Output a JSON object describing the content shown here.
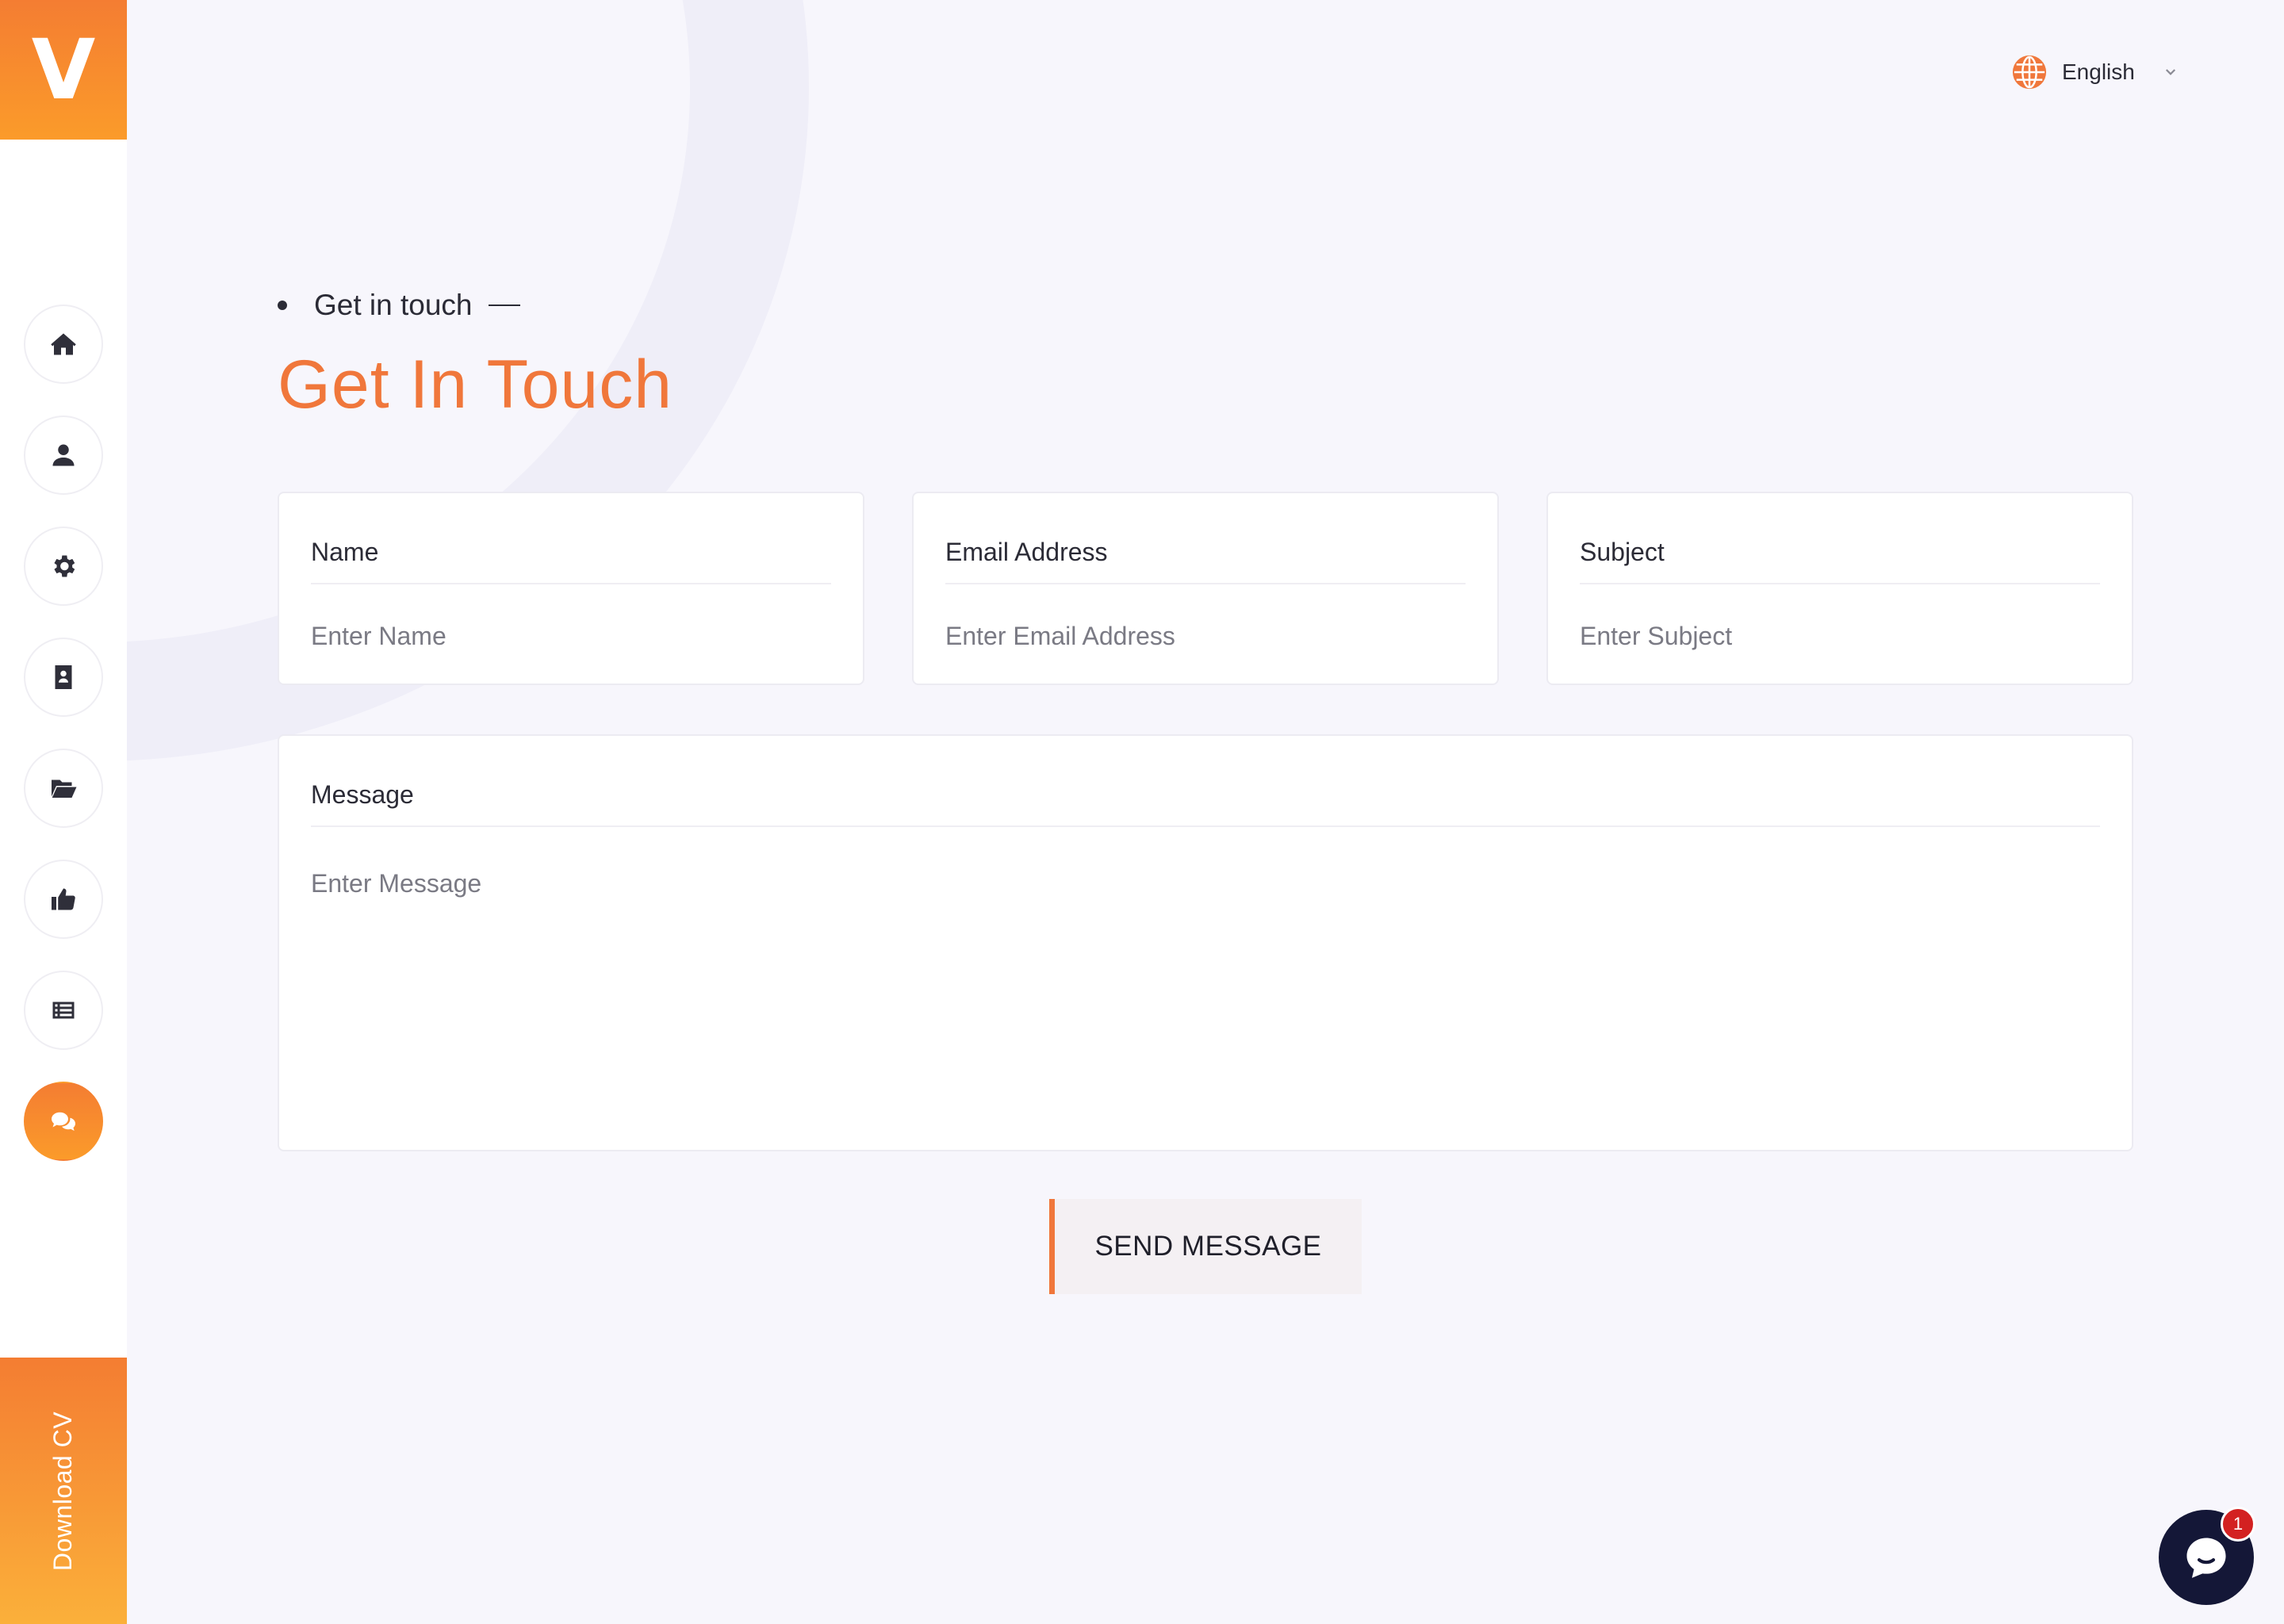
{
  "brand": {
    "logo_letter": "V",
    "accent": "#f0773b"
  },
  "sidebar": {
    "items": [
      {
        "icon": "home-icon",
        "active": false
      },
      {
        "icon": "user-icon",
        "active": false
      },
      {
        "icon": "gear-icon",
        "active": false
      },
      {
        "icon": "contact-card-icon",
        "active": false
      },
      {
        "icon": "folder-open-icon",
        "active": false
      },
      {
        "icon": "thumbs-up-icon",
        "active": false
      },
      {
        "icon": "news-list-icon",
        "active": false
      },
      {
        "icon": "chat-icon",
        "active": true
      }
    ],
    "download_label": "Download CV"
  },
  "language": {
    "icon": "globe-icon",
    "selected": "English"
  },
  "header": {
    "eyebrow": "Get in touch",
    "title": "Get In Touch"
  },
  "form": {
    "name": {
      "label": "Name",
      "placeholder": "Enter Name",
      "value": ""
    },
    "email": {
      "label": "Email Address",
      "placeholder": "Enter Email Address",
      "value": ""
    },
    "subject": {
      "label": "Subject",
      "placeholder": "Enter Subject",
      "value": ""
    },
    "message": {
      "label": "Message",
      "placeholder": "Enter Message",
      "value": ""
    },
    "submit_label": "SEND MESSAGE"
  },
  "chat_widget": {
    "icon": "chat-bubble-icon",
    "unread_count": "1"
  }
}
